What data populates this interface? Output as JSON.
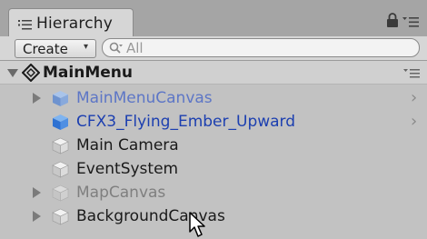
{
  "header": {
    "tab_title": "Hierarchy",
    "tab_icon": "list-icon",
    "lock_icon": "lock-icon",
    "menu_icon": "panel-menu-icon"
  },
  "toolbar": {
    "create_label": "Create",
    "create_arrow": "▾",
    "search_placeholder": "All",
    "search_icon": "search-icon"
  },
  "tree": {
    "scene": {
      "name": "MainMenu",
      "icon": "unity-logo-icon",
      "menu_icon": "scene-menu-icon"
    },
    "items": [
      {
        "label": "MainMenuCanvas",
        "style": "blue-faded",
        "expandable": true,
        "has_arrow": true,
        "icon": "prefab-cube-icon"
      },
      {
        "label": "CFX3_Flying_Ember_Upward",
        "style": "blue",
        "expandable": false,
        "has_arrow": true,
        "icon": "prefab-cube-icon"
      },
      {
        "label": "Main Camera",
        "style": "normal",
        "expandable": false,
        "has_arrow": false,
        "icon": "gameobject-cube-icon"
      },
      {
        "label": "EventSystem",
        "style": "normal",
        "expandable": false,
        "has_arrow": false,
        "icon": "gameobject-cube-icon"
      },
      {
        "label": "MapCanvas",
        "style": "grey",
        "expandable": true,
        "has_arrow": false,
        "icon": "gameobject-cube-icon"
      },
      {
        "label": "BackgroundCanvas",
        "style": "normal",
        "expandable": true,
        "has_arrow": false,
        "icon": "gameobject-cube-icon"
      }
    ],
    "chevron": "›"
  },
  "colors": {
    "prefab_blue": "#1c3fb0",
    "prefab_blue_faded": "#5d76c6",
    "disabled_grey": "#7f7f7f",
    "panel_bg": "#c2c2c2"
  }
}
